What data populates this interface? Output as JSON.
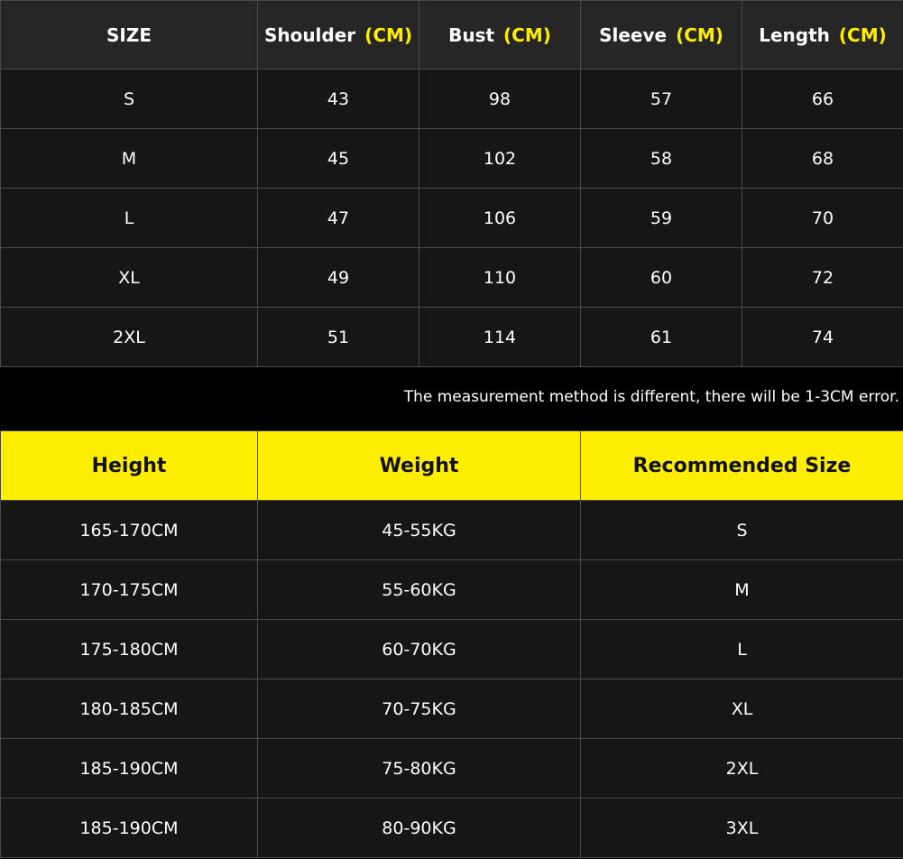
{
  "size_chart": {
    "headers": [
      {
        "label": "SIZE",
        "unit": ""
      },
      {
        "label": "Shoulder",
        "unit": "(CM)"
      },
      {
        "label": "Bust",
        "unit": "(CM)"
      },
      {
        "label": "Sleeve",
        "unit": "(CM)"
      },
      {
        "label": "Length",
        "unit": "(CM)"
      }
    ],
    "rows": [
      [
        "S",
        "43",
        "98",
        "57",
        "66"
      ],
      [
        "M",
        "45",
        "102",
        "58",
        "68"
      ],
      [
        "L",
        "47",
        "106",
        "59",
        "70"
      ],
      [
        "XL",
        "49",
        "110",
        "60",
        "72"
      ],
      [
        "2XL",
        "51",
        "114",
        "61",
        "74"
      ]
    ]
  },
  "note": "The measurement method is different, there will be 1-3CM error.",
  "recommendation": {
    "headers": [
      "Height",
      "Weight",
      "Recommended Size"
    ],
    "rows": [
      [
        "165-170CM",
        "45-55KG",
        "S"
      ],
      [
        "170-175CM",
        "55-60KG",
        "M"
      ],
      [
        "175-180CM",
        "60-70KG",
        "L"
      ],
      [
        "180-185CM",
        "70-75KG",
        "XL"
      ],
      [
        "185-190CM",
        "75-80KG",
        "2XL"
      ],
      [
        "185-190CM",
        "80-90KG",
        "3XL"
      ]
    ]
  },
  "colors": {
    "accent_yellow": "#ffee00",
    "header_dark": "#262626",
    "cell_dark": "#161616",
    "grid_line": "#4a4a4a"
  }
}
